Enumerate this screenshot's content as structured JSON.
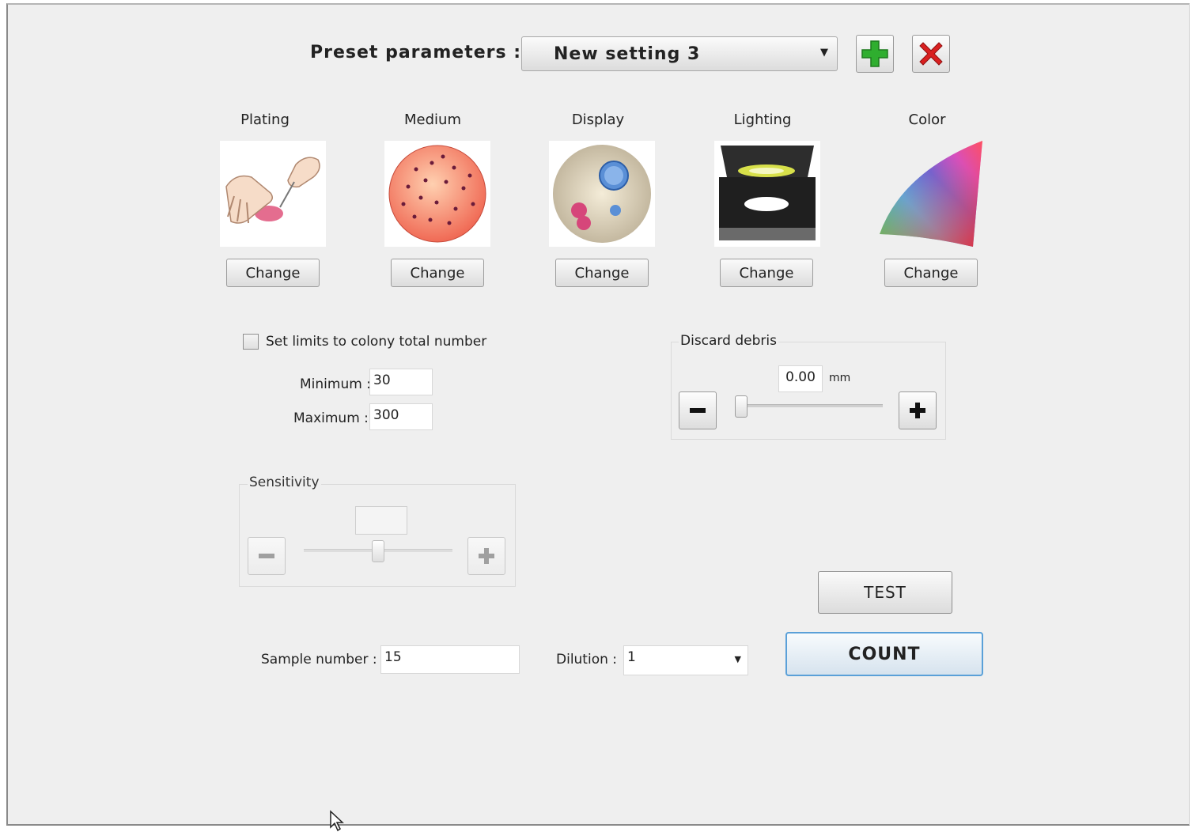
{
  "preset": {
    "label": "Preset parameters :",
    "selected": "New setting 3",
    "add_icon": "plus-icon",
    "delete_icon": "delete-x-icon"
  },
  "categories": [
    {
      "label": "Plating",
      "icon": "plating-hands-icon",
      "button": "Change"
    },
    {
      "label": "Medium",
      "icon": "petri-dish-icon",
      "button": "Change"
    },
    {
      "label": "Display",
      "icon": "display-circle-icon",
      "button": "Change"
    },
    {
      "label": "Lighting",
      "icon": "lighting-device-icon",
      "button": "Change"
    },
    {
      "label": "Color",
      "icon": "color-gamut-icon",
      "button": "Change"
    }
  ],
  "limits": {
    "checkbox_label": "Set limits to colony total number",
    "checked": false,
    "min_label": "Minimum :",
    "min_value": "30",
    "max_label": "Maximum :",
    "max_value": "300"
  },
  "debris": {
    "title": "Discard debris",
    "value": "0.00",
    "unit": "mm",
    "slider_fraction": 0.0
  },
  "sensitivity": {
    "title": "Sensitivity",
    "value": "",
    "slider_fraction": 0.5,
    "enabled": false
  },
  "sample": {
    "label": "Sample number :",
    "value": "15"
  },
  "dilution": {
    "label": "Dilution :",
    "value": "1"
  },
  "actions": {
    "test": "TEST",
    "count": "COUNT"
  },
  "colors": {
    "background": "#efefef",
    "add_green": "#2fae2f",
    "delete_red": "#d92020",
    "count_border": "#5aa0d8"
  }
}
